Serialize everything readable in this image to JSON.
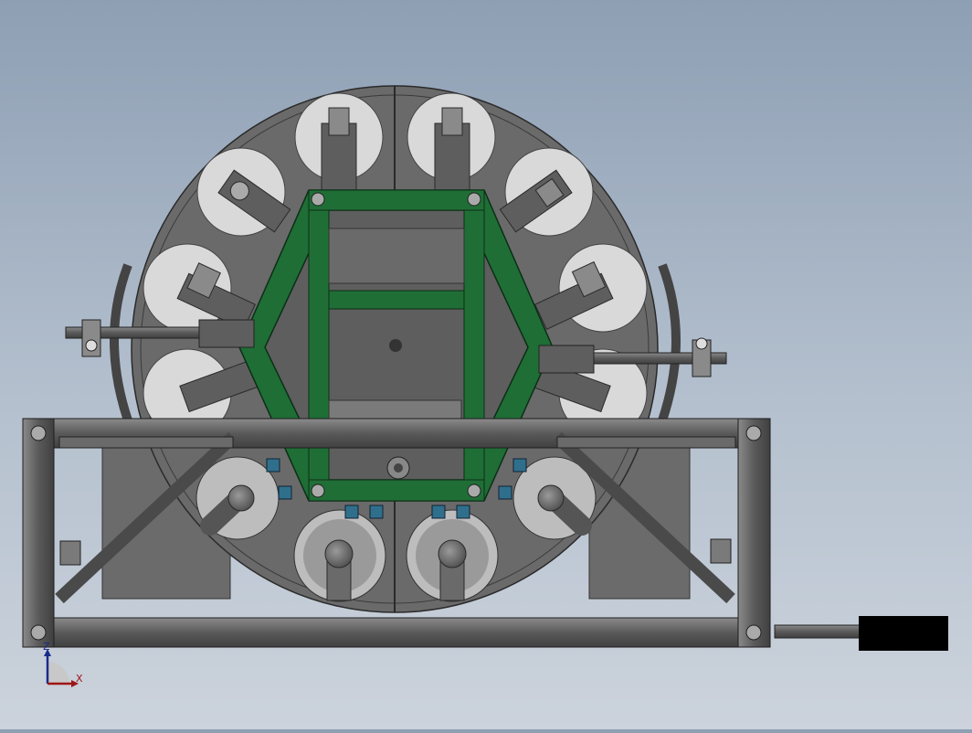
{
  "triad": {
    "z_label": "Z",
    "x_label": "X"
  },
  "colors": {
    "background_top": "#8e9fb4",
    "background_bottom": "#ccd3dc",
    "disc": "#6a6a6a",
    "frame_green": "#1f6e36",
    "bearing_blue": "#2f6f8c",
    "steel": "#5c5c5c",
    "pocket": "#d8d8d8"
  },
  "icons": {
    "triad": "xyz-axis-triad-icon"
  }
}
